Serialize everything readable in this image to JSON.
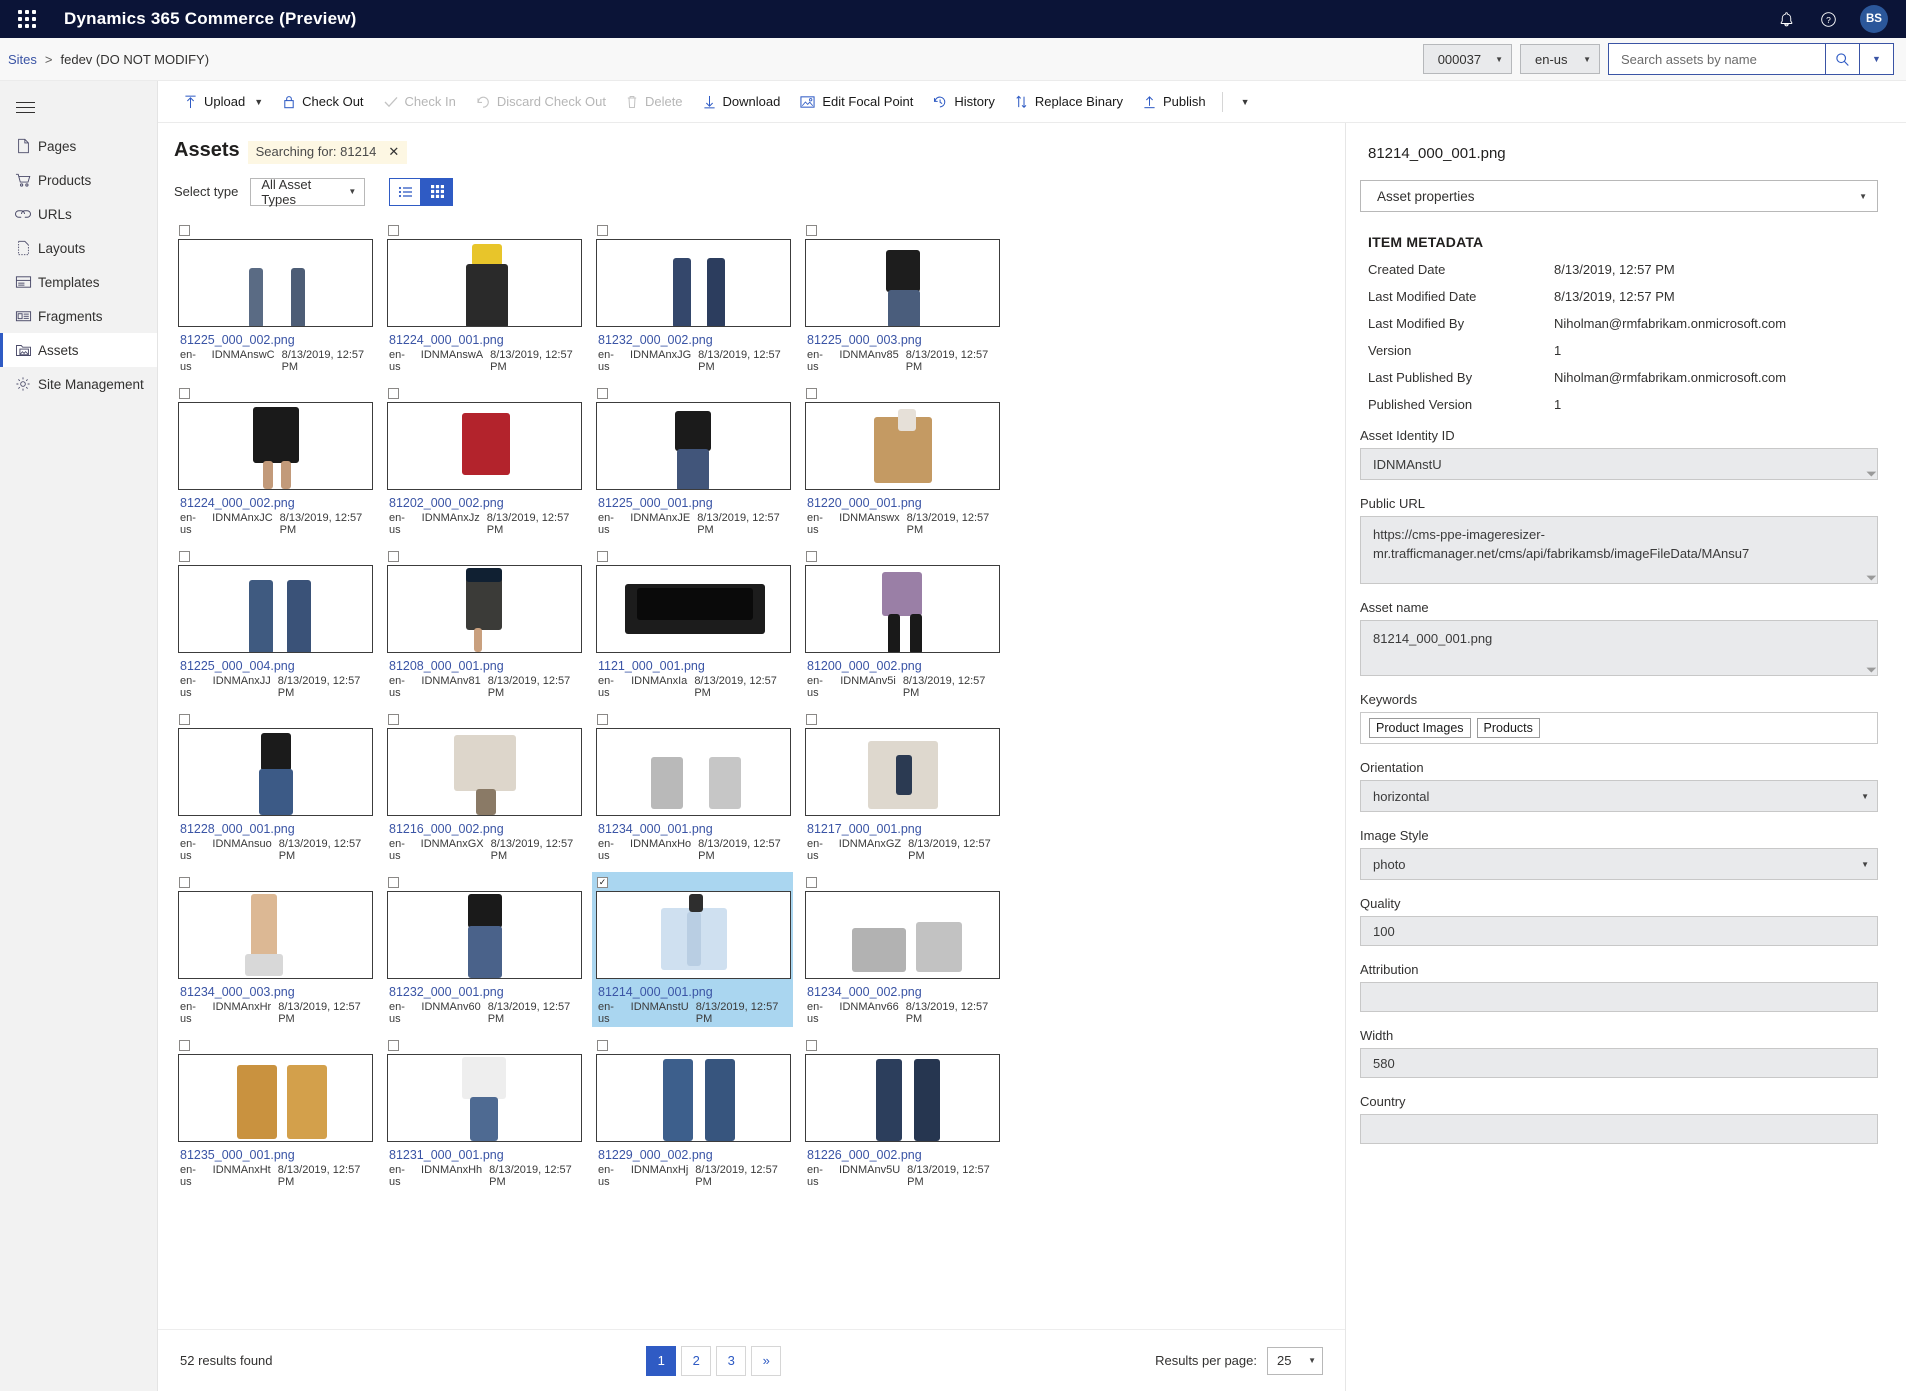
{
  "topbar": {
    "app_title": "Dynamics 365 Commerce (Preview)",
    "waffle_icon": "app-launcher-icon",
    "notification_icon": "bell-icon",
    "help_icon": "question-icon",
    "avatar_initials": "BS",
    "accent": "#0b1437"
  },
  "breadcrumb": {
    "root": "Sites",
    "separator": ">",
    "current": "fedev (DO NOT MODIFY)"
  },
  "header_controls": {
    "channel": "000037",
    "locale": "en-us",
    "search_placeholder": "Search assets by name",
    "search_value": "",
    "search_icon": "magnifier-icon",
    "search_dropdown_icon": "chevron-down-icon"
  },
  "sidebar": {
    "menu_icon": "hamburger-icon",
    "items": [
      {
        "label": "Pages",
        "icon": "page-icon",
        "active": false
      },
      {
        "label": "Products",
        "icon": "cart-icon",
        "active": false
      },
      {
        "label": "URLs",
        "icon": "link-icon",
        "active": false
      },
      {
        "label": "Layouts",
        "icon": "layout-icon",
        "active": false
      },
      {
        "label": "Templates",
        "icon": "template-icon",
        "active": false
      },
      {
        "label": "Fragments",
        "icon": "fragment-icon",
        "active": false
      },
      {
        "label": "Assets",
        "icon": "assets-folder-icon",
        "active": true
      },
      {
        "label": "Site Management",
        "icon": "gear-icon",
        "active": false
      }
    ]
  },
  "toolbar": {
    "items": [
      {
        "label": "Upload",
        "icon": "upload-arrow-icon",
        "disabled": false,
        "caret": true
      },
      {
        "label": "Check Out",
        "icon": "lock-icon",
        "disabled": false,
        "caret": false
      },
      {
        "label": "Check In",
        "icon": "checkmark-icon",
        "disabled": true,
        "caret": false
      },
      {
        "label": "Discard Check Out",
        "icon": "undo-icon",
        "disabled": true,
        "caret": false
      },
      {
        "label": "Delete",
        "icon": "trash-icon",
        "disabled": true,
        "caret": false
      },
      {
        "label": "Download",
        "icon": "download-arrow-icon",
        "disabled": false,
        "caret": false
      },
      {
        "label": "Edit Focal Point",
        "icon": "focal-point-icon",
        "disabled": false,
        "caret": false
      },
      {
        "label": "History",
        "icon": "clock-history-icon",
        "disabled": false,
        "caret": false
      },
      {
        "label": "Replace Binary",
        "icon": "swap-vertical-icon",
        "disabled": false,
        "caret": false
      },
      {
        "label": "Publish",
        "icon": "publish-arrow-icon",
        "disabled": false,
        "caret": false
      }
    ],
    "overflow_icon": "chevron-down-icon"
  },
  "assets": {
    "title": "Assets",
    "search_tag": "Searching for: 81214",
    "search_tag_clear": "✕",
    "select_type_label": "Select type",
    "asset_type_value": "All Asset Types",
    "view_list_icon": "list-view-icon",
    "view_grid_icon": "grid-view-icon",
    "active_view": "grid",
    "tiles": [
      {
        "name": "81225_000_002.png",
        "locale": "en-us",
        "id": "IDNMAnswC",
        "date": "8/13/2019, 12:57 PM",
        "art": "jeans-dark",
        "selected": false
      },
      {
        "name": "81224_000_001.png",
        "locale": "en-us",
        "id": "IDNMAnswA",
        "date": "8/13/2019, 12:57 PM",
        "art": "yellow-top",
        "selected": false
      },
      {
        "name": "81232_000_002.png",
        "locale": "en-us",
        "id": "IDNMAnxJG",
        "date": "8/13/2019, 12:57 PM",
        "art": "jeans-mid",
        "selected": false
      },
      {
        "name": "81225_000_003.png",
        "locale": "en-us",
        "id": "IDNMAnv85",
        "date": "8/13/2019, 12:57 PM",
        "art": "black-top-jeans",
        "selected": false
      },
      {
        "name": "81224_000_002.png",
        "locale": "en-us",
        "id": "IDNMAnxJC",
        "date": "8/13/2019, 12:57 PM",
        "art": "black-skirt",
        "selected": false
      },
      {
        "name": "81202_000_002.png",
        "locale": "en-us",
        "id": "IDNMAnxJz",
        "date": "8/13/2019, 12:57 PM",
        "art": "red-dress",
        "selected": false
      },
      {
        "name": "81225_000_001.png",
        "locale": "en-us",
        "id": "IDNMAnxJE",
        "date": "8/13/2019, 12:57 PM",
        "art": "black-tee-jeans",
        "selected": false
      },
      {
        "name": "81220_000_001.png",
        "locale": "en-us",
        "id": "IDNMAnswx",
        "date": "8/13/2019, 12:57 PM",
        "art": "tan-jacket",
        "selected": false
      },
      {
        "name": "81225_000_004.png",
        "locale": "en-us",
        "id": "IDNMAnxJJ",
        "date": "8/13/2019, 12:57 PM",
        "art": "blue-jeans-wide",
        "selected": false
      },
      {
        "name": "81208_000_001.png",
        "locale": "en-us",
        "id": "IDNMAnv81",
        "date": "8/13/2019, 12:57 PM",
        "art": "grey-dress",
        "selected": false
      },
      {
        "name": "1121_000_001.png",
        "locale": "en-us",
        "id": "IDNMAnxIa",
        "date": "8/13/2019, 12:57 PM",
        "art": "laptop",
        "selected": false
      },
      {
        "name": "81200_000_002.png",
        "locale": "en-us",
        "id": "IDNMAnv5i",
        "date": "8/13/2019, 12:57 PM",
        "art": "striped-dress",
        "selected": false
      },
      {
        "name": "81228_000_001.png",
        "locale": "en-us",
        "id": "IDNMAnsuo",
        "date": "8/13/2019, 12:57 PM",
        "art": "black-top-blue-jeans",
        "selected": false
      },
      {
        "name": "81216_000_002.png",
        "locale": "en-us",
        "id": "IDNMAnxGX",
        "date": "8/13/2019, 12:57 PM",
        "art": "cream-sweater",
        "selected": false
      },
      {
        "name": "81234_000_001.png",
        "locale": "en-us",
        "id": "IDNMAnxHo",
        "date": "8/13/2019, 12:57 PM",
        "art": "heels-pair",
        "selected": false
      },
      {
        "name": "81217_000_001.png",
        "locale": "en-us",
        "id": "IDNMAnxGZ",
        "date": "8/13/2019, 12:57 PM",
        "art": "cardigan",
        "selected": false
      },
      {
        "name": "81234_000_003.png",
        "locale": "en-us",
        "id": "IDNMAnxHr",
        "date": "8/13/2019, 12:57 PM",
        "art": "legs-heel",
        "selected": false
      },
      {
        "name": "81232_000_001.png",
        "locale": "en-us",
        "id": "IDNMAnv60",
        "date": "8/13/2019, 12:57 PM",
        "art": "black-top-jeans2",
        "selected": false
      },
      {
        "name": "81214_000_001.png",
        "locale": "en-us",
        "id": "IDNMAnstU",
        "date": "8/13/2019, 12:57 PM",
        "art": "blue-shirt",
        "selected": true
      },
      {
        "name": "81234_000_002.png",
        "locale": "en-us",
        "id": "IDNMAnv66",
        "date": "8/13/2019, 12:57 PM",
        "art": "grey-heels",
        "selected": false
      },
      {
        "name": "81235_000_001.png",
        "locale": "en-us",
        "id": "IDNMAnxHt",
        "date": "8/13/2019, 12:57 PM",
        "art": "boots",
        "selected": false
      },
      {
        "name": "81231_000_001.png",
        "locale": "en-us",
        "id": "IDNMAnxHh",
        "date": "8/13/2019, 12:57 PM",
        "art": "white-top-jeans",
        "selected": false
      },
      {
        "name": "81229_000_002.png",
        "locale": "en-us",
        "id": "IDNMAnxHj",
        "date": "8/13/2019, 12:57 PM",
        "art": "blue-jeans-flare",
        "selected": false
      },
      {
        "name": "81226_000_002.png",
        "locale": "en-us",
        "id": "IDNMAnv5U",
        "date": "8/13/2019, 12:57 PM",
        "art": "dark-jeans",
        "selected": false
      }
    ]
  },
  "pagination": {
    "results_text": "52 results found",
    "pages": [
      "1",
      "2",
      "3",
      "»"
    ],
    "current_page": "1",
    "results_per_page_label": "Results per page:",
    "results_per_page_value": "25"
  },
  "details": {
    "title": "81214_000_001.png",
    "properties_select": "Asset properties",
    "metadata_heading": "ITEM METADATA",
    "metadata": [
      {
        "key": "Created Date",
        "value": "8/13/2019, 12:57 PM"
      },
      {
        "key": "Last Modified Date",
        "value": "8/13/2019, 12:57 PM"
      },
      {
        "key": "Last Modified By",
        "value": "Niholman@rmfabrikam.onmicrosoft.com"
      },
      {
        "key": "Version",
        "value": "1"
      },
      {
        "key": "Last Published By",
        "value": "Niholman@rmfabrikam.onmicrosoft.com"
      },
      {
        "key": "Published Version",
        "value": "1"
      }
    ],
    "fields": {
      "asset_identity_id_label": "Asset Identity ID",
      "asset_identity_id_value": "IDNMAnstU",
      "public_url_label": "Public URL",
      "public_url_value": "https://cms-ppe-imageresizer-mr.trafficmanager.net/cms/api/fabrikamsb/imageFileData/MAnsu7",
      "asset_name_label": "Asset name",
      "asset_name_value": "81214_000_001.png",
      "keywords_label": "Keywords",
      "keywords": [
        "Product Images",
        "Products"
      ],
      "orientation_label": "Orientation",
      "orientation_value": "horizontal",
      "image_style_label": "Image Style",
      "image_style_value": "photo",
      "quality_label": "Quality",
      "quality_value": "100",
      "attribution_label": "Attribution",
      "attribution_value": "",
      "width_label": "Width",
      "width_value": "580",
      "country_label": "Country",
      "country_value": ""
    }
  }
}
